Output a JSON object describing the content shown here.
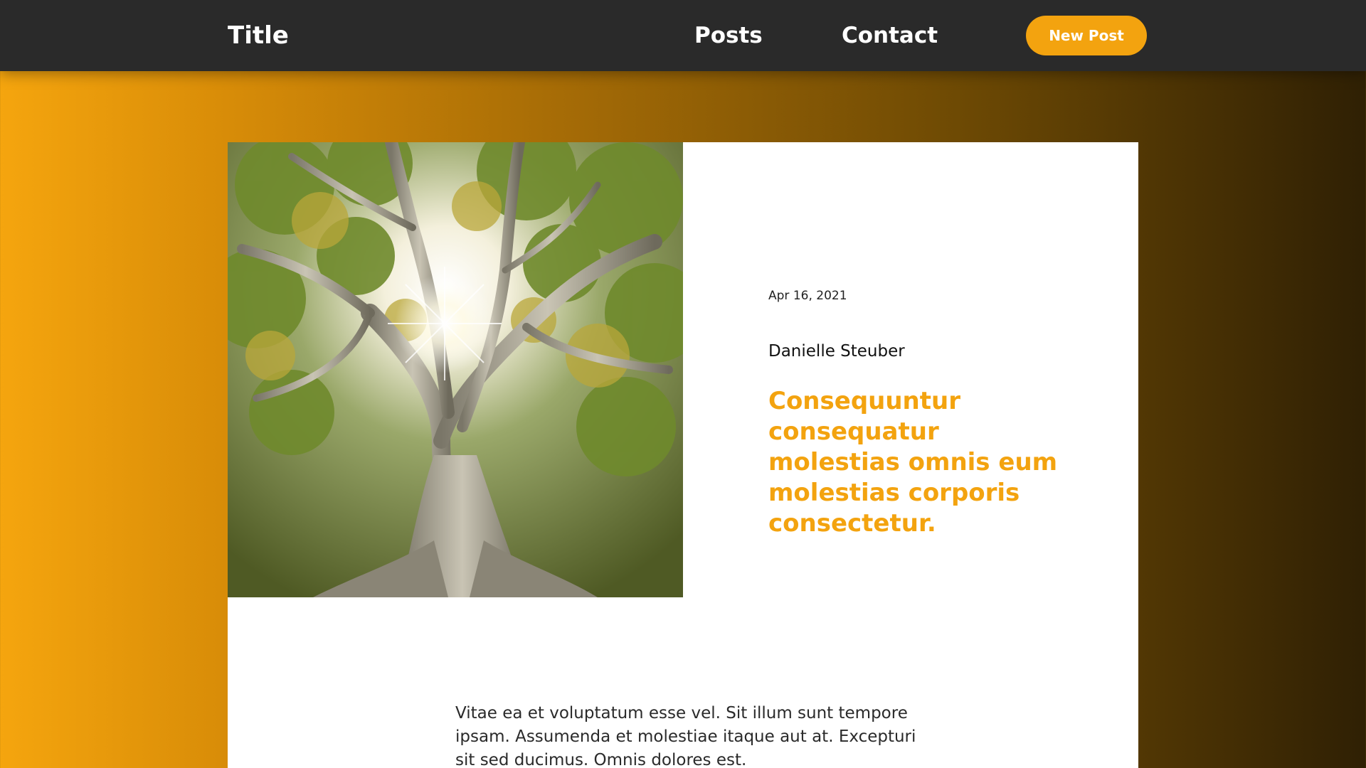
{
  "nav": {
    "brand": "Title",
    "links": [
      "Posts",
      "Contact"
    ],
    "new_post_label": "New Post"
  },
  "post": {
    "image_icon": "tree-photo",
    "date": "Apr 16, 2021",
    "author": "Danielle Steuber",
    "title": "Consequuntur consequatur molestias omnis eum molestias corporis consectetur.",
    "body": "Vitae ea et voluptatum esse vel. Sit illum sunt tempore ipsam. Assumenda et molestiae itaque aut at. Excepturi sit sed ducimus. Omnis dolores est."
  },
  "colors": {
    "accent": "#f3a30f",
    "navbar": "#2a2a2a",
    "gradient_start": "#f5a50e",
    "gradient_end": "#2f2004"
  }
}
